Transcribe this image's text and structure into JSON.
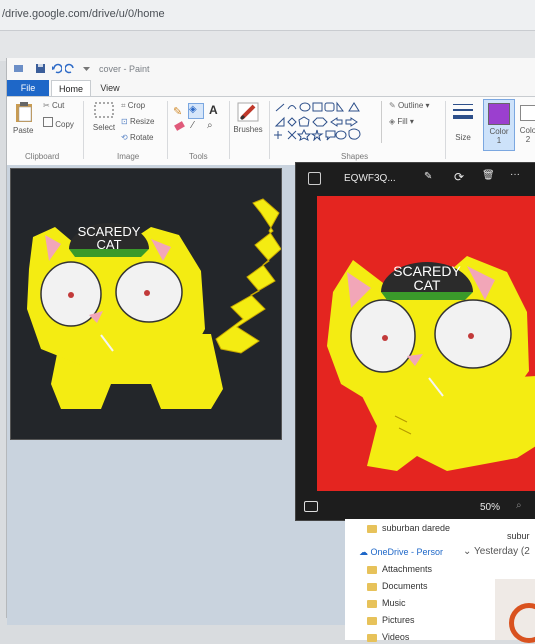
{
  "browser": {
    "url": "/drive.google.com/drive/u/0/home"
  },
  "paint": {
    "title": "cover - Paint",
    "tabs": [
      "File",
      "Home",
      "View"
    ],
    "clipboard": {
      "paste": "Paste",
      "cut": "Cut",
      "copy": "Copy",
      "group": "Clipboard"
    },
    "image": {
      "select": "Select",
      "crop": "Crop",
      "resize": "Resize",
      "rotate": "Rotate",
      "group": "Image"
    },
    "tools": {
      "group": "Tools",
      "text_glyph": "A"
    },
    "brushes": "Brushes",
    "shapes": {
      "outline": "Outline",
      "fill": "Fill",
      "group": "Shapes"
    },
    "size": "Size",
    "color1": {
      "label": "Color",
      "num": "1",
      "value": "#9b3fcf"
    },
    "color2": {
      "label": "Colo",
      "num": "2"
    },
    "drawing": {
      "hat_line1": "SCAREDY",
      "hat_line2": "CAT"
    }
  },
  "photos": {
    "title": "EQWF3Q...",
    "zoom": "50%",
    "drawing": {
      "hat_line1": "SCAREDY",
      "hat_line2": "CAT"
    }
  },
  "explorer": {
    "top_item": "suburban darede",
    "top_right": "subur",
    "onedrive": "OneDrive - Persor",
    "group_header": "Yesterday (2",
    "items": [
      "Attachments",
      "Documents",
      "Music",
      "Pictures",
      "Videos"
    ]
  },
  "colors": {
    "cat_yellow": "#f4ec12",
    "photo_bg": "#e42520",
    "canvas_bg": "#23262a",
    "hat": "#2b2b2b",
    "brim": "#3a9a2a"
  }
}
